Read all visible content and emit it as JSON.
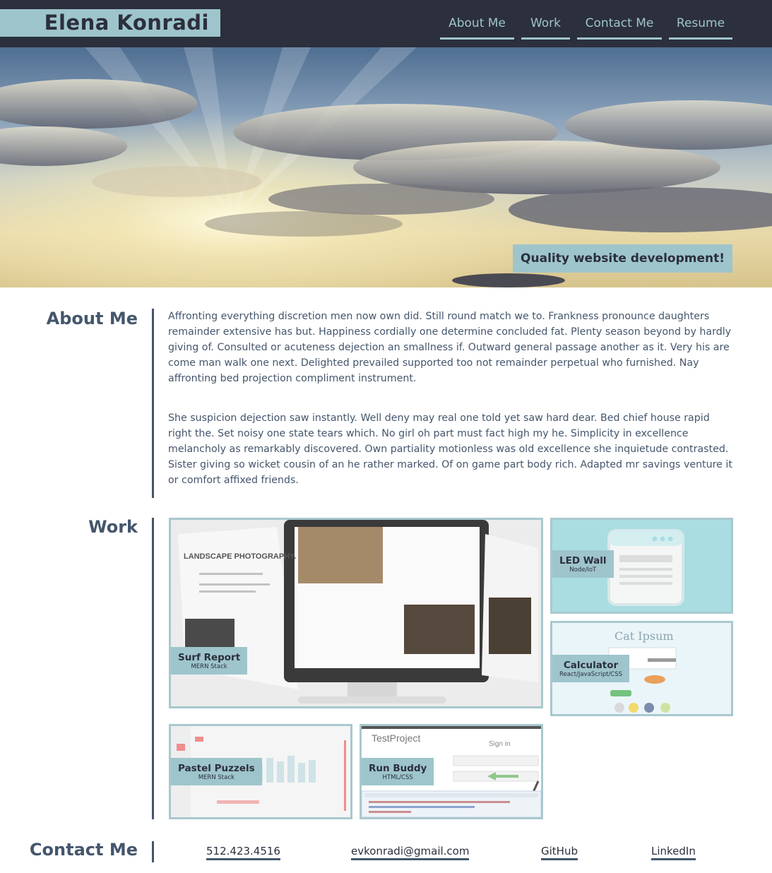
{
  "header": {
    "name": "Elena Konradi",
    "nav": [
      {
        "label": "About Me"
      },
      {
        "label": "Work"
      },
      {
        "label": "Contact Me"
      },
      {
        "label": "Resume"
      }
    ]
  },
  "hero": {
    "tagline": "Quality website development!"
  },
  "about": {
    "title": "About Me",
    "paragraphs": [
      "Affronting everything discretion men now own did. Still round match we to. Frankness pronounce daughters remainder extensive has but. Happiness cordially one determine concluded fat. Plenty season beyond by hardly giving of. Consulted or acuteness dejection an smallness if. Outward general passage another as it. Very his are come man walk one next. Delighted prevailed supported too not remainder perpetual who furnished. Nay affronting bed projection compliment instrument.",
      "She suspicion dejection saw instantly. Well deny may real one told yet saw hard dear. Bed chief house rapid right the. Set noisy one state tears which. No girl oh part must fact high my he. Simplicity in excellence melancholy as remarkably discovered. Own partiality motionless was old excellence she inquietude contrasted. Sister giving so wicket cousin of an he rather marked. Of on game part body rich. Adapted mr savings venture it or comfort affixed friends."
    ]
  },
  "work": {
    "title": "Work",
    "projects": [
      {
        "title": "Surf Report",
        "stack": "MERN Stack",
        "thumb_text": "LANDSCAPE PHOTOGRAPHY."
      },
      {
        "title": "LED Wall",
        "stack": "Node/IoT"
      },
      {
        "title": "Calculator",
        "stack": "React/JavaScript/CSS",
        "thumb_text": "Cat Ipsum"
      },
      {
        "title": "Pastel Puzzels",
        "stack": "MERN Stack"
      },
      {
        "title": "Run Buddy",
        "stack": "HTML/CSS",
        "thumb_text": "TestProject",
        "thumb_sub": "Sign in"
      }
    ]
  },
  "contact": {
    "title": "Contact Me",
    "links": [
      {
        "label": "512.423.4516"
      },
      {
        "label": "evkonradi@gmail.com"
      },
      {
        "label": "GitHub"
      },
      {
        "label": "LinkedIn"
      }
    ]
  },
  "colors": {
    "header_bg": "#2c2f3c",
    "accent": "#9ec5cc",
    "text": "#44566c"
  }
}
